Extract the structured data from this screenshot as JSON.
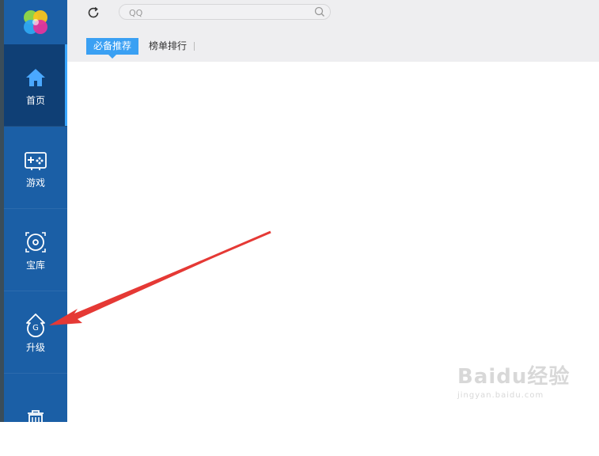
{
  "sidebar": {
    "items": [
      {
        "label": "首页",
        "icon": "home-icon",
        "active": true
      },
      {
        "label": "游戏",
        "icon": "gamepad-icon",
        "active": false
      },
      {
        "label": "宝库",
        "icon": "disc-icon",
        "active": false
      },
      {
        "label": "升级",
        "icon": "upgrade-icon",
        "active": false
      },
      {
        "label": "",
        "icon": "trash-icon",
        "active": false
      }
    ]
  },
  "search": {
    "placeholder": "QQ"
  },
  "tabs": [
    {
      "label": "必备推荐",
      "active": true
    },
    {
      "label": "榜单排行",
      "active": false
    }
  ],
  "watermark": {
    "main": "Baidu经验",
    "sub": "jingyan.baidu.com"
  },
  "colors": {
    "sidebar": "#1b5fa6",
    "sidebar_active": "#0f3f75",
    "tab_active": "#3aa0f3",
    "annotation_arrow": "#e53935"
  }
}
